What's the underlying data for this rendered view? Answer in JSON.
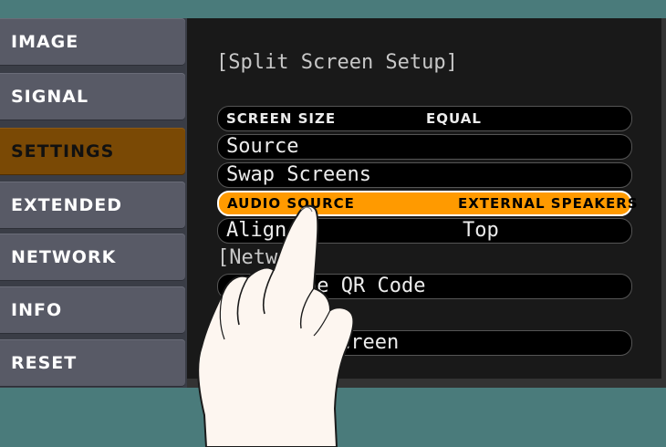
{
  "sidebar": {
    "items": [
      {
        "label": "IMAGE",
        "active": false
      },
      {
        "label": "SIGNAL",
        "active": false
      },
      {
        "label": "SETTINGS",
        "active": true
      },
      {
        "label": "EXTENDED",
        "active": false
      },
      {
        "label": "NETWORK",
        "active": false
      },
      {
        "label": "INFO",
        "active": false
      },
      {
        "label": "RESET",
        "active": false
      }
    ]
  },
  "main": {
    "section_split": "[Split Screen Setup]",
    "section_network": "[Netwo",
    "rows": {
      "screen_size": {
        "label": "SCREEN SIZE",
        "value": "EQUAL"
      },
      "source": {
        "label": "Source"
      },
      "swap_screens": {
        "label": "Swap Screens"
      },
      "audio_source": {
        "label": "AUDIO SOURCE",
        "value": "EXTERNAL SPEAKERS"
      },
      "align": {
        "label": "Align",
        "value": "Top"
      },
      "qr_code": {
        "label": "he QR Code"
      },
      "screen": {
        "label": "creen"
      }
    }
  },
  "colors": {
    "background": "#4a7b7b",
    "menu_item": "#585a66",
    "menu_active": "#7a4905",
    "highlight": "#ff9a00",
    "panel": "#191919"
  },
  "icons": {
    "overlay": "pointing-hand-icon"
  }
}
